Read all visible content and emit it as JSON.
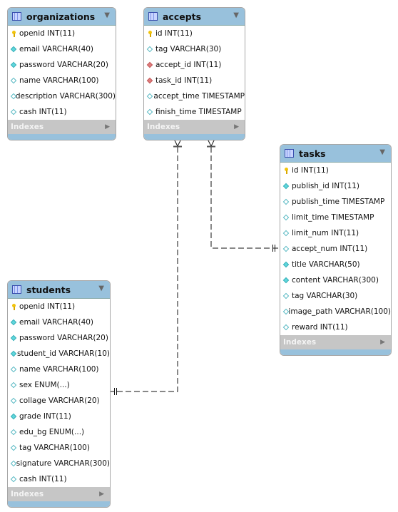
{
  "tables": [
    {
      "name": "organizations",
      "indexes_label": "Indexes",
      "columns": [
        {
          "text": "openid INT(11)",
          "icon": "key"
        },
        {
          "text": "email VARCHAR(40)",
          "icon": "nn"
        },
        {
          "text": "password VARCHAR(20)",
          "icon": "nn"
        },
        {
          "text": "name VARCHAR(100)",
          "icon": "null"
        },
        {
          "text": "description VARCHAR(300)",
          "icon": "null"
        },
        {
          "text": "cash INT(11)",
          "icon": "null"
        }
      ]
    },
    {
      "name": "accepts",
      "indexes_label": "Indexes",
      "columns": [
        {
          "text": "id INT(11)",
          "icon": "key"
        },
        {
          "text": "tag VARCHAR(30)",
          "icon": "null"
        },
        {
          "text": "accept_id INT(11)",
          "icon": "fk"
        },
        {
          "text": "task_id INT(11)",
          "icon": "fk"
        },
        {
          "text": "accept_time TIMESTAMP",
          "icon": "null"
        },
        {
          "text": "finish_time TIMESTAMP",
          "icon": "null"
        }
      ]
    },
    {
      "name": "tasks",
      "indexes_label": "Indexes",
      "columns": [
        {
          "text": "id INT(11)",
          "icon": "key"
        },
        {
          "text": "publish_id INT(11)",
          "icon": "nn"
        },
        {
          "text": "publish_time TIMESTAMP",
          "icon": "null"
        },
        {
          "text": "limit_time TIMESTAMP",
          "icon": "null"
        },
        {
          "text": "limit_num INT(11)",
          "icon": "null"
        },
        {
          "text": "accept_num INT(11)",
          "icon": "null"
        },
        {
          "text": "title VARCHAR(50)",
          "icon": "nn"
        },
        {
          "text": "content VARCHAR(300)",
          "icon": "nn"
        },
        {
          "text": "tag VARCHAR(30)",
          "icon": "null"
        },
        {
          "text": "image_path VARCHAR(100)",
          "icon": "null"
        },
        {
          "text": "reward INT(11)",
          "icon": "null"
        }
      ]
    },
    {
      "name": "students",
      "indexes_label": "Indexes",
      "columns": [
        {
          "text": "openid INT(11)",
          "icon": "key"
        },
        {
          "text": "email VARCHAR(40)",
          "icon": "nn"
        },
        {
          "text": "password VARCHAR(20)",
          "icon": "nn"
        },
        {
          "text": "student_id VARCHAR(10)",
          "icon": "nn"
        },
        {
          "text": "name VARCHAR(100)",
          "icon": "null"
        },
        {
          "text": "sex ENUM(...)",
          "icon": "null"
        },
        {
          "text": "collage VARCHAR(20)",
          "icon": "null"
        },
        {
          "text": "grade INT(11)",
          "icon": "nn"
        },
        {
          "text": "edu_bg ENUM(...)",
          "icon": "null"
        },
        {
          "text": "tag VARCHAR(100)",
          "icon": "null"
        },
        {
          "text": "signature VARCHAR(300)",
          "icon": "null"
        },
        {
          "text": "cash INT(11)",
          "icon": "null"
        }
      ]
    }
  ],
  "relationships": [
    {
      "from": "accepts",
      "to": "students",
      "cardinality": "many-to-one",
      "style": "dashed"
    },
    {
      "from": "accepts",
      "to": "tasks",
      "cardinality": "many-to-one",
      "style": "dashed"
    }
  ],
  "colors": {
    "header": "#98c1dc",
    "indexes": "#c6c6c6",
    "key": "#f2c40a",
    "not_null": "#5fd6dc",
    "foreign_key": "#e07c7c"
  }
}
